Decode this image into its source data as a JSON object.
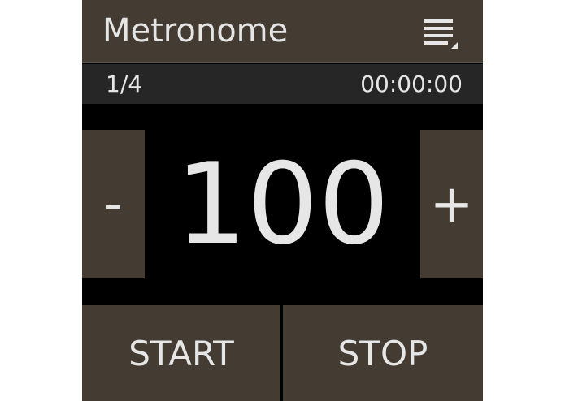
{
  "header": {
    "title": "Metronome",
    "menu_icon": "menu-list-icon"
  },
  "status": {
    "time_signature": "1/4",
    "timer": "00:00:00"
  },
  "tempo": {
    "value": "100",
    "decrease_label": "-",
    "increase_label": "+"
  },
  "controls": {
    "start_label": "START",
    "stop_label": "STOP"
  },
  "colors": {
    "panel": "#443c33",
    "status_bar": "#262626",
    "background": "#000000",
    "text": "#e6e6e6"
  }
}
